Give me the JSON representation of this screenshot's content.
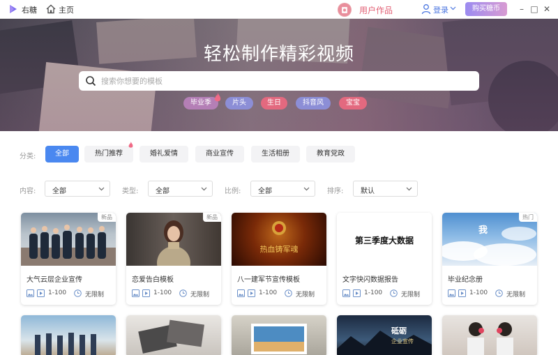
{
  "titlebar": {
    "app_name": "右糖",
    "home_label": "主页",
    "user_works": "用户作品",
    "login": "登录",
    "buy_button": "购买糖币",
    "minimize": "–",
    "maximize": "□",
    "close": "✕"
  },
  "hero": {
    "title": "轻松制作精彩视频",
    "search_placeholder": "搜索你想要的模板",
    "tags": [
      "毕业季",
      "片头",
      "生日",
      "抖音风",
      "宝宝"
    ]
  },
  "filters": {
    "category_label": "分类:",
    "categories": [
      "全部",
      "热门推荐",
      "婚礼爱情",
      "商业宣传",
      "生活相册",
      "教育党政"
    ],
    "active_category": "全部",
    "dropdowns": [
      {
        "label": "内容:",
        "value": "全部"
      },
      {
        "label": "类型:",
        "value": "全部"
      },
      {
        "label": "比例:",
        "value": "全部"
      },
      {
        "label": "排序:",
        "value": "默认"
      }
    ]
  },
  "cards": [
    {
      "title": "大气云层企业宣传",
      "badge": "新品",
      "count": "1-100",
      "duration": "无限制"
    },
    {
      "title": "恋爱告白模板",
      "badge": "新品",
      "count": "1-100",
      "duration": "无限制"
    },
    {
      "title": "八一建军节宣传模板",
      "badge": "",
      "count": "1-100",
      "duration": "无限制",
      "thumb_text": "热血铸军魂"
    },
    {
      "title": "文字快闪数据报告",
      "badge": "",
      "count": "1-100",
      "duration": "无限制",
      "thumb_text": "第三季度大数据"
    },
    {
      "title": "毕业纪念册",
      "badge": "热门",
      "count": "1-100",
      "duration": "无限制",
      "thumb_text": "我"
    }
  ],
  "row2": {
    "card4_text1": "砥砺",
    "card4_text2": "企业宣传"
  },
  "colors": {
    "accent_blue": "#4a88f0",
    "tag_colors": [
      "#b47fb6",
      "#8c8ed6",
      "#e3697f",
      "#8c8ed6",
      "#e3697f"
    ],
    "user_works": "#e25f74"
  }
}
